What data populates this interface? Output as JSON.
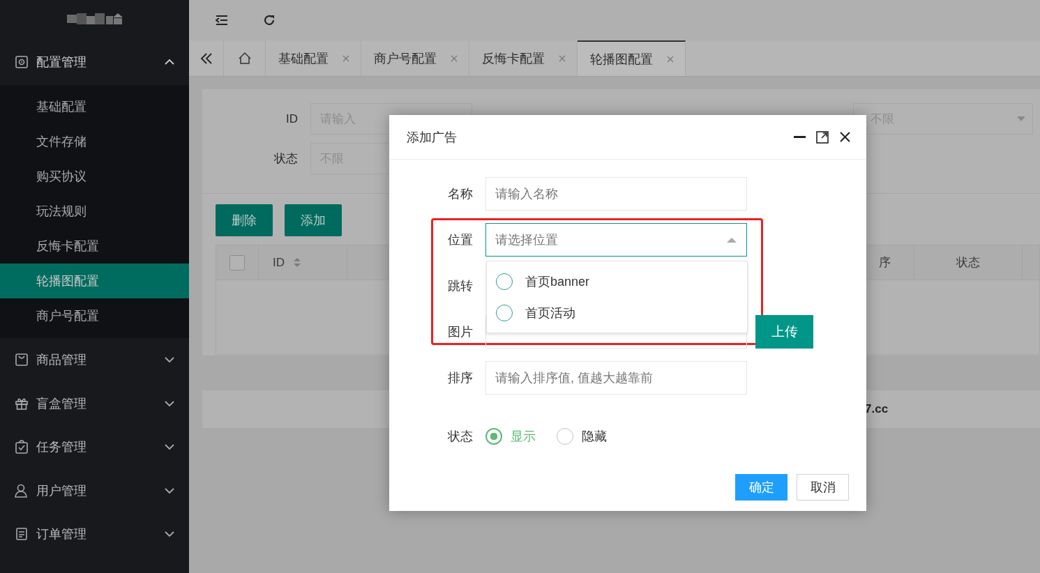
{
  "sidebar": {
    "menu": [
      {
        "label": "配置管理",
        "expanded": true,
        "children": [
          {
            "label": "基础配置",
            "selected": false
          },
          {
            "label": "文件存储",
            "selected": false
          },
          {
            "label": "购买协议",
            "selected": false
          },
          {
            "label": "玩法规则",
            "selected": false
          },
          {
            "label": "反悔卡配置",
            "selected": false
          },
          {
            "label": "轮播图配置",
            "selected": true
          },
          {
            "label": "商户号配置",
            "selected": false
          }
        ]
      },
      {
        "label": "商品管理",
        "expanded": false
      },
      {
        "label": "盲盒管理",
        "expanded": false
      },
      {
        "label": "任务管理",
        "expanded": false
      },
      {
        "label": "用户管理",
        "expanded": false
      },
      {
        "label": "订单管理",
        "expanded": false
      }
    ]
  },
  "tabs": [
    {
      "label": "基础配置",
      "selected": false
    },
    {
      "label": "商户号配置",
      "selected": false
    },
    {
      "label": "反悔卡配置",
      "selected": false
    },
    {
      "label": "轮播图配置",
      "selected": true
    }
  ],
  "search": {
    "fields": [
      {
        "label": "ID",
        "placeholder": "请输入"
      },
      {
        "label": "状态",
        "placeholder": "不限"
      }
    ],
    "select": {
      "placeholder": "不限"
    }
  },
  "actions": [
    "删除",
    "添加"
  ],
  "table": {
    "select_all": {
      "checked": false
    },
    "columns": [
      {
        "label": "ID",
        "sortable": true
      },
      {
        "label": "序",
        "sortable": false
      },
      {
        "label": "状态",
        "sortable": false
      }
    ]
  },
  "footer": {
    "text": "7.cc"
  },
  "dialog": {
    "title": "添加广告",
    "rows": [
      {
        "kind": "text",
        "label": "名称",
        "placeholder": "请输入名称"
      },
      {
        "kind": "select",
        "label": "位置",
        "placeholder": "请选择位置",
        "expanded": true,
        "options": [
          {
            "label": "首页banner",
            "selected": false
          },
          {
            "label": "首页活动",
            "selected": false
          }
        ]
      },
      {
        "kind": "hidden",
        "label": "跳转"
      },
      {
        "kind": "upload",
        "label": "图片",
        "button": "上传"
      },
      {
        "kind": "text",
        "label": "排序",
        "placeholder": "请输入排序值, 值越大越靠前"
      },
      {
        "kind": "radio",
        "label": "状态",
        "options": [
          {
            "label": "显示",
            "selected": true
          },
          {
            "label": "隐藏",
            "selected": false
          }
        ]
      }
    ],
    "buttons": [
      {
        "label": "确定",
        "primary": true
      },
      {
        "label": "取消",
        "primary": false
      }
    ]
  }
}
